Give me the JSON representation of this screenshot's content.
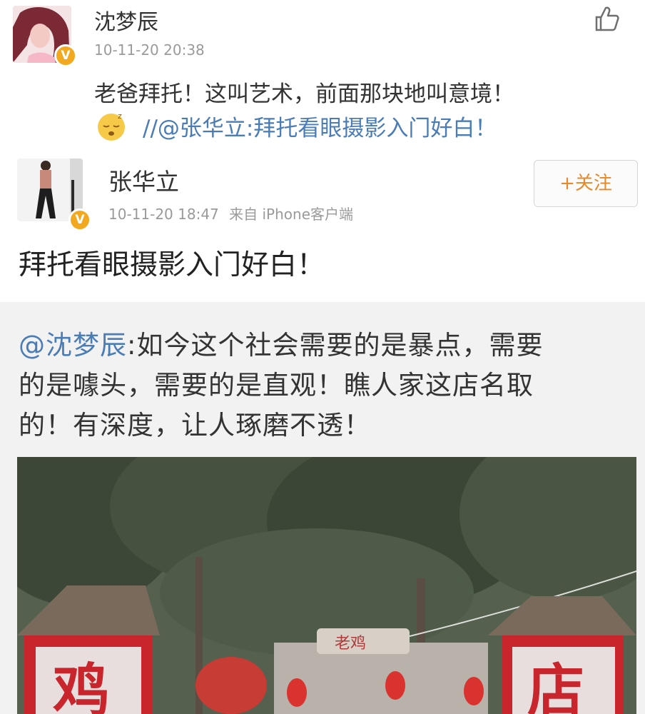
{
  "comment": {
    "username": "沈梦辰",
    "timestamp": "10-11-20 20:38",
    "text": "老爸拜托！这叫艺术，前面那块地叫意境！",
    "quote_prefix": "//",
    "quote_mention": "@张华立",
    "quote_text": ":拜托看眼摄影入门好白！",
    "verified_mark": "V",
    "like_icon": "thumbs-up-icon",
    "emoji_icon": "sleepy-face-emoji"
  },
  "post": {
    "username": "张华立",
    "timestamp": "10-11-20 18:47",
    "source": "来自 iPhone客户端",
    "text": "拜托看眼摄影入门好白！",
    "follow_label": "+关注",
    "verified_mark": "V"
  },
  "repost": {
    "mention": "@沈梦辰",
    "line1_rest": ":如今这个社会需要的是暴点，需要",
    "line2": "的是噱头，需要的是直观！瞧人家这店名取",
    "line3": "的！有深度，让人琢磨不透！"
  },
  "photo": {
    "sign_left": "鸡",
    "sign_right": "店",
    "banner": "老鸡",
    "colors": {
      "trees": "#3e4a3a",
      "sign_red": "#c8252d",
      "roof": "#6c5b4d"
    }
  },
  "colors": {
    "link": "#4a7cb6",
    "follow": "#e58a2b",
    "badge": "#f2a91f",
    "repost_bg": "#f2f2f2"
  }
}
